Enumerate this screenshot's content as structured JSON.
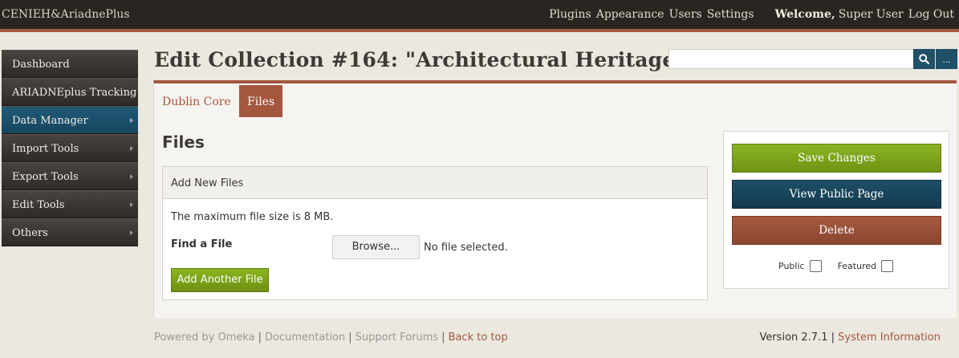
{
  "header": {
    "site_title": "CENIEH&AriadnePlus",
    "nav": [
      "Plugins",
      "Appearance",
      "Users",
      "Settings"
    ],
    "welcome_label": "Welcome,",
    "user_name": "Super User",
    "logout": "Log Out"
  },
  "sidebar": {
    "items": [
      {
        "label": "Dashboard"
      },
      {
        "label": "ARIADNEplus Tracking"
      },
      {
        "label": "Data Manager"
      },
      {
        "label": "Import Tools"
      },
      {
        "label": "Export Tools"
      },
      {
        "label": "Edit Tools"
      },
      {
        "label": "Others"
      }
    ]
  },
  "page": {
    "title": "Edit Collection #164: \"Architectural Heritage\"",
    "search_placeholder": "",
    "search_more_label": "..."
  },
  "tabs": [
    {
      "label": "Dublin Core"
    },
    {
      "label": "Files"
    }
  ],
  "files_section": {
    "title": "Files",
    "panel_title": "Add New Files",
    "max_size_text": "The maximum file size is 8 MB.",
    "find_label": "Find a File",
    "browse_label": "Browse...",
    "no_file_text": "No file selected.",
    "add_another_label": "Add Another File"
  },
  "actions": {
    "save": "Save Changes",
    "view_public": "View Public Page",
    "delete": "Delete",
    "public_label": "Public",
    "featured_label": "Featured"
  },
  "footer": {
    "powered": "Powered by Omeka",
    "documentation": "Documentation",
    "support": "Support Forums",
    "back_to_top": "Back to top",
    "version": "Version 2.7.1",
    "system_info": "System Information"
  },
  "colors": {
    "accent": "#a4573f",
    "topbar": "#2b2521",
    "active_nav": "#1f5a77",
    "save_green": "#7ea51c",
    "view_blue": "#1d4f66"
  },
  "icons": [
    "search-icon"
  ]
}
